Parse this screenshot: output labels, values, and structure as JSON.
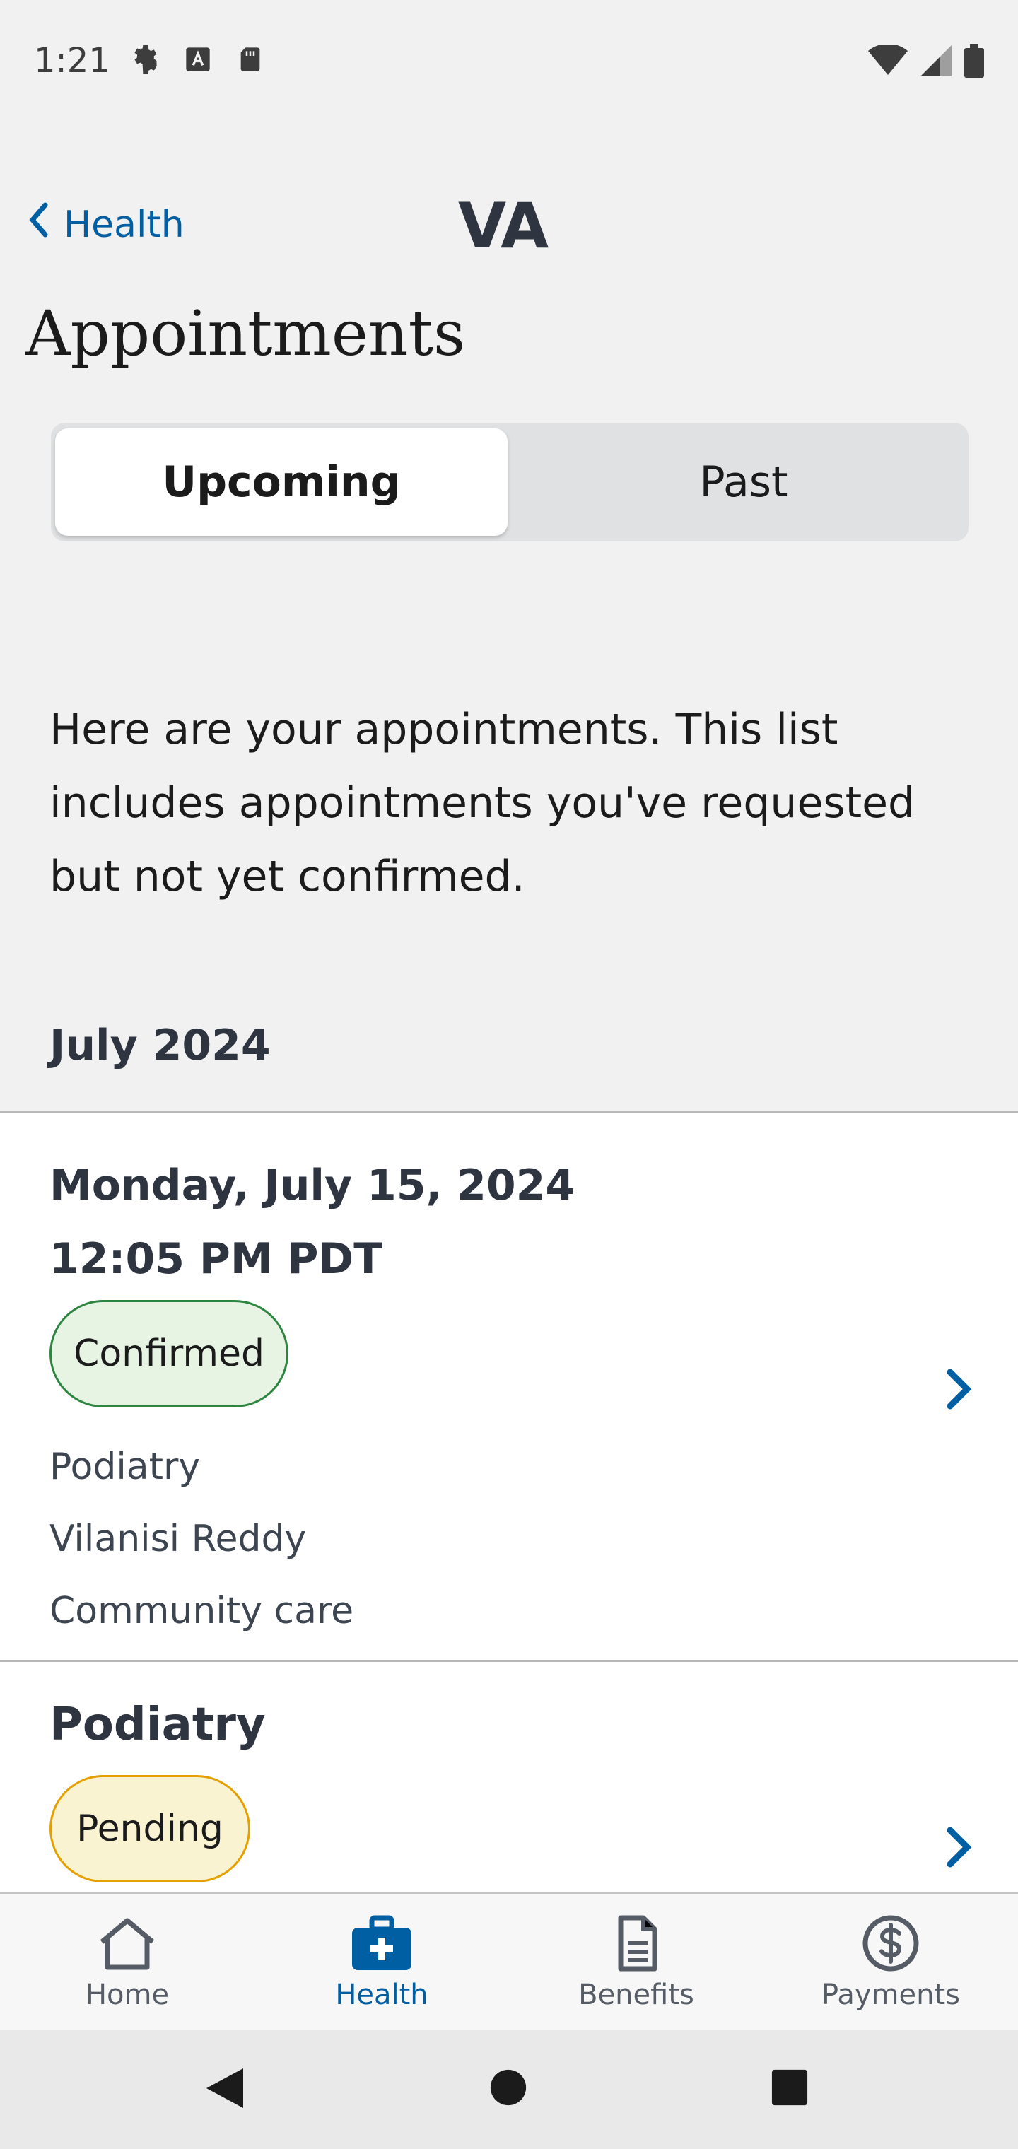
{
  "status_bar": {
    "time": "1:21",
    "icons_left": [
      "gear-icon",
      "font-a-icon",
      "sd-card-icon"
    ],
    "icons_right": [
      "wifi-icon",
      "signal-icon",
      "battery-icon"
    ]
  },
  "header": {
    "back_label": "Health",
    "logo_text": "VA",
    "title": "Appointments"
  },
  "tabs": {
    "upcoming": "Upcoming",
    "past": "Past",
    "selected": "Upcoming"
  },
  "intro_text": "Here are your appointments. This list includes appointments you've requested but not yet confirmed.",
  "month_header": "July 2024",
  "appointments": [
    {
      "date": "Monday, July 15, 2024",
      "time": "12:05 PM PDT",
      "status": "Confirmed",
      "type": "Podiatry",
      "provider": "Vilanisi Reddy",
      "location": "Community care"
    },
    {
      "title": "Podiatry",
      "status": "Pending"
    }
  ],
  "bottom_nav": {
    "items": [
      {
        "label": "Home",
        "icon": "home-icon"
      },
      {
        "label": "Health",
        "icon": "medical-kit-icon"
      },
      {
        "label": "Benefits",
        "icon": "document-icon"
      },
      {
        "label": "Payments",
        "icon": "dollar-circle-icon"
      }
    ],
    "active": "Health"
  },
  "colors": {
    "link_blue": "#005ea2",
    "confirmed_bg": "#e7f4e4",
    "confirmed_border": "#2e8540",
    "pending_bg": "#faf3d1",
    "pending_border": "#e5a000"
  }
}
